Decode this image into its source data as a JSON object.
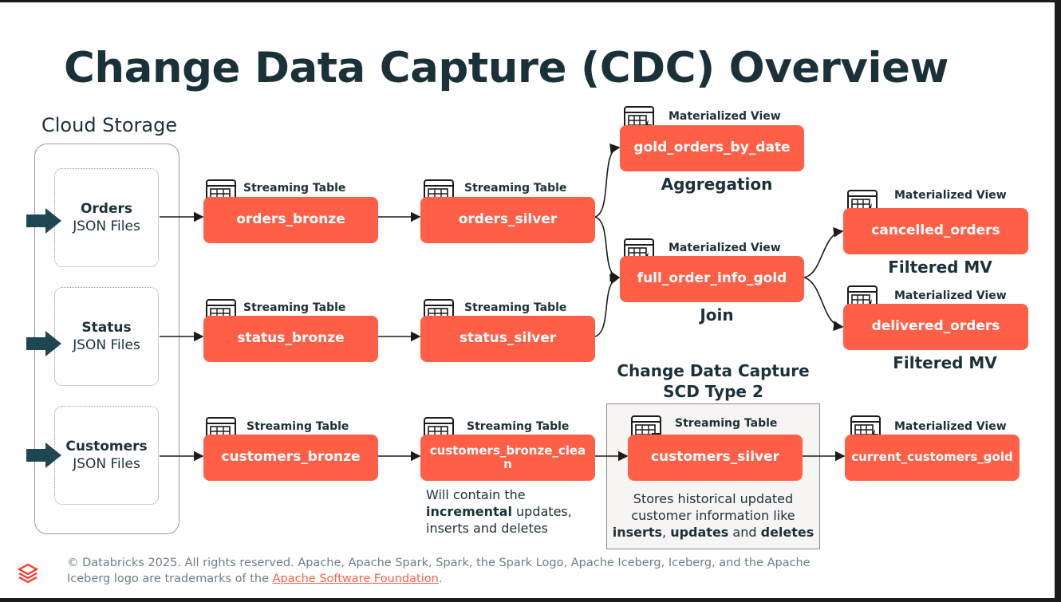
{
  "title": "Change Data Capture (CDC) Overview",
  "cloud_storage_label": "Cloud Storage",
  "sources": [
    {
      "name": "Orders",
      "format": "JSON Files"
    },
    {
      "name": "Status",
      "format": "JSON Files"
    },
    {
      "name": "Customers",
      "format": "JSON Files"
    }
  ],
  "tags": {
    "streaming": "Streaming Table",
    "mv": "Materialized View"
  },
  "nodes": {
    "orders_bronze": "orders_bronze",
    "orders_silver": "orders_silver",
    "status_bronze": "status_bronze",
    "status_silver": "status_silver",
    "customers_bronze": "customers_bronze",
    "customers_bronze_clean_1": "customers_bronze_clea",
    "customers_bronze_clean_2": "n",
    "customers_silver": "customers_silver",
    "gold_orders_by_date": "gold_orders_by_date",
    "full_order_info_gold": "full_order_info_gold",
    "cancelled_orders": "cancelled_orders",
    "delivered_orders": "delivered_orders",
    "current_customers_gold": "current_customers_gold"
  },
  "captions": {
    "aggregation": "Aggregation",
    "join": "Join",
    "filtered_mv_1": "Filtered MV",
    "filtered_mv_2": "Filtered MV",
    "cdc_title_1": "Change Data Capture",
    "cdc_title_2": "SCD Type 2"
  },
  "notes": {
    "bronze_clean": {
      "l1": "Will contain the",
      "b1": "incremental",
      "l2": " updates,",
      "l3": "inserts and deletes"
    },
    "silver": {
      "l1": "Stores historical updated",
      "l2": "customer information like",
      "b1": "inserts",
      "s1": ", ",
      "b2": "updates",
      "s2": " and ",
      "b3": "deletes"
    }
  },
  "footer": {
    "text1": "© Databricks 2025. All rights reserved. Apache, Apache Spark, Spark, the Spark Logo, Apache Iceberg, Iceberg, and the Apache",
    "text2": "Iceberg logo are trademarks of the ",
    "link": "Apache Software Foundation",
    "text3": "."
  },
  "colors": {
    "node": "#ff5f46",
    "text": "#1b3139",
    "arrow_dark": "#1f4653"
  }
}
